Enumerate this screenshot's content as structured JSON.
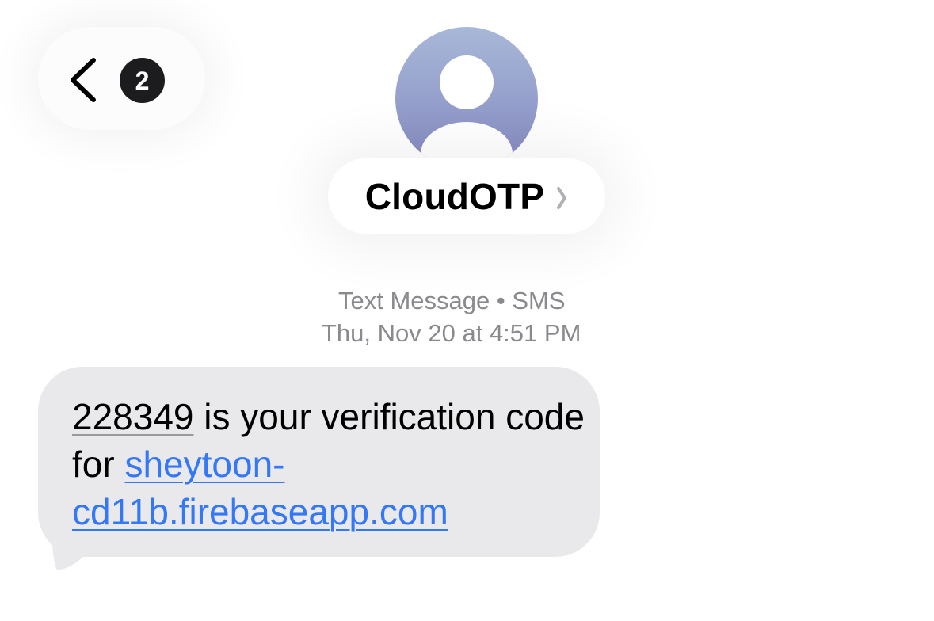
{
  "header": {
    "back_badge_count": "2",
    "contact_name": "CloudOTP"
  },
  "meta": {
    "channel": "Text Message • SMS",
    "timestamp": "Thu, Nov 20 at 4:51 PM"
  },
  "message": {
    "code": "228349",
    "text_part_1": " is your verification code for ",
    "link_line_1": "sheytoon-",
    "link_line_2": "cd11b.firebaseapp.com"
  },
  "colors": {
    "bubble": "#e9e9eb",
    "link": "#3478f6",
    "badge": "#1c1c1e",
    "meta_text": "#8a8a8e"
  },
  "icons": [
    "chevron-left-icon",
    "person-silhouette-icon",
    "chevron-right-icon"
  ]
}
